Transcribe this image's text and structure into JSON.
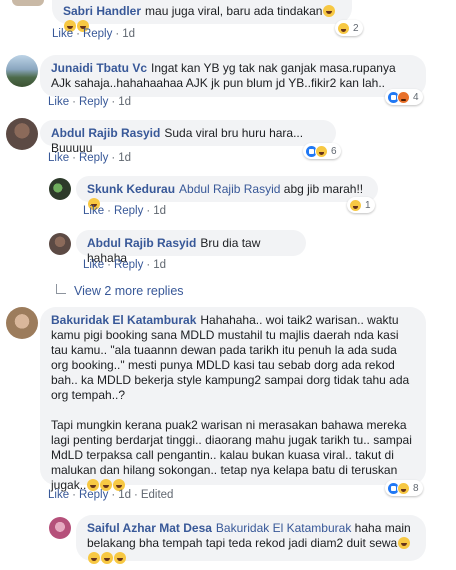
{
  "actions": {
    "like": "Like",
    "reply": "Reply",
    "edited": "Edited",
    "sep": "·"
  },
  "comments": [
    {
      "author": "Sabri Handler",
      "text": "mau juga viral, baru ada tindakan",
      "time": "1d",
      "react_count": "2"
    },
    {
      "author": "Junaidi Tbatu Vc",
      "text": "Ingat kan YB yg tak nak ganjak masa.rupanya AJk sahaja..hahahaahaa AJK jk pun blum jd YB..fikir2 kan lah..",
      "time": "1d",
      "react_count": "4"
    },
    {
      "author": "Abdul Rajib Rasyid",
      "text": "Suda viral bru huru hara... Buuuuu",
      "time": "1d",
      "react_count": "6"
    },
    {
      "author": "Skunk Kedurau",
      "mention": "Abdul Rajib Rasyid",
      "text": "abg jib marah!!",
      "time": "1d",
      "react_count": "1"
    },
    {
      "author": "Abdul Rajib Rasyid",
      "text": "Bru dia taw hahaha",
      "time": "1d"
    },
    {
      "author": "Bakuridak El Katamburak",
      "text": "Hahahaha.. woi taik2 warisan.. waktu kamu pigi booking sana MDLD mustahil tu majlis daerah nda kasi tau kamu.. \"ala tuaannn dewan pada tarikh itu penuh la ada suda org booking..\" mesti punya MDLD kasi tau sebab dorg ada rekod bah.. ka MDLD bekerja style kampung2 sampai dorg tidak tahu ada org tempah..?",
      "text2": "Tapi mungkin kerana puak2 warisan ni merasakan bahawa mereka lagi penting berdarjat tinggi.. diaorang mahu jugak tarikh tu.. sampai MdLD terpaksa call pengantin.. kalau bukan kuasa viral.. takut di malukan dan hilang sokongan.. tetap nya kelapa batu di teruskan jugak..",
      "time": "1d",
      "react_count": "8"
    },
    {
      "author": "Saiful Azhar Mat Desa",
      "mention": "Bakuridak El Katamburak",
      "text": "haha main belakang bha tempah tapi teda rekod jadi diam2 duit sewa",
      "time": ""
    }
  ],
  "view_more": "View 2 more replies",
  "colors": {
    "link": "#385898",
    "bubble": "#f2f3f5",
    "meta": "#606770"
  }
}
